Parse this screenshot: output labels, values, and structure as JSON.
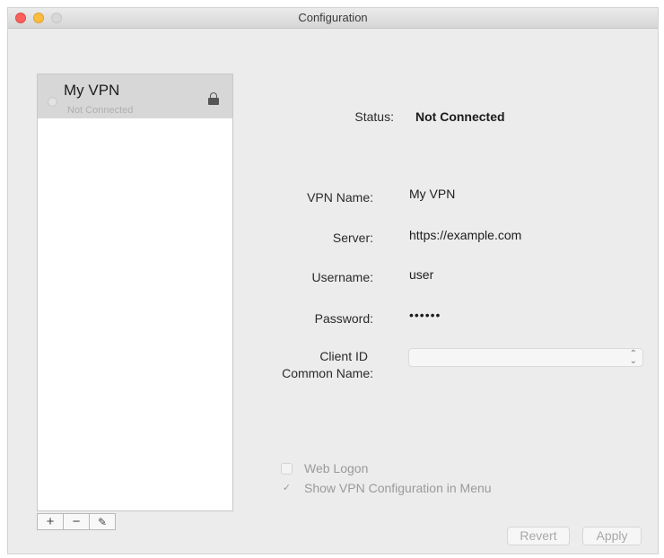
{
  "window": {
    "title": "Configuration"
  },
  "sidebar": {
    "items": [
      {
        "name": "My VPN",
        "status": "Not Connected"
      }
    ],
    "tools": {
      "add": "+",
      "remove": "−",
      "edit": "✎"
    }
  },
  "form": {
    "status_label": "Status:",
    "status_value": "Not Connected",
    "vpn_name_label": "VPN Name:",
    "vpn_name_value": "My VPN",
    "server_label": "Server:",
    "server_value": "https://example.com",
    "username_label": "Username:",
    "username_value": "user",
    "password_label": "Password:",
    "password_value": "••••••",
    "client_id_label_line1": "Client ID",
    "client_id_label_line2": "Common Name:",
    "client_id_value": ""
  },
  "options": {
    "web_logon": {
      "label": "Web Logon",
      "checked": false
    },
    "show_in_menu": {
      "label": "Show VPN Configuration in Menu",
      "checked": true
    }
  },
  "buttons": {
    "revert": "Revert",
    "apply": "Apply"
  },
  "icons": {
    "lock": "lock-icon",
    "select": "up-down-chevron-icon",
    "check": "checkmark-icon"
  },
  "colors": {
    "close": "#fc605c",
    "minimize": "#fdbc40",
    "zoom_disabled": "#d8d8d8",
    "window_bg": "#ececec",
    "selected_row": "#d7d7d7"
  }
}
